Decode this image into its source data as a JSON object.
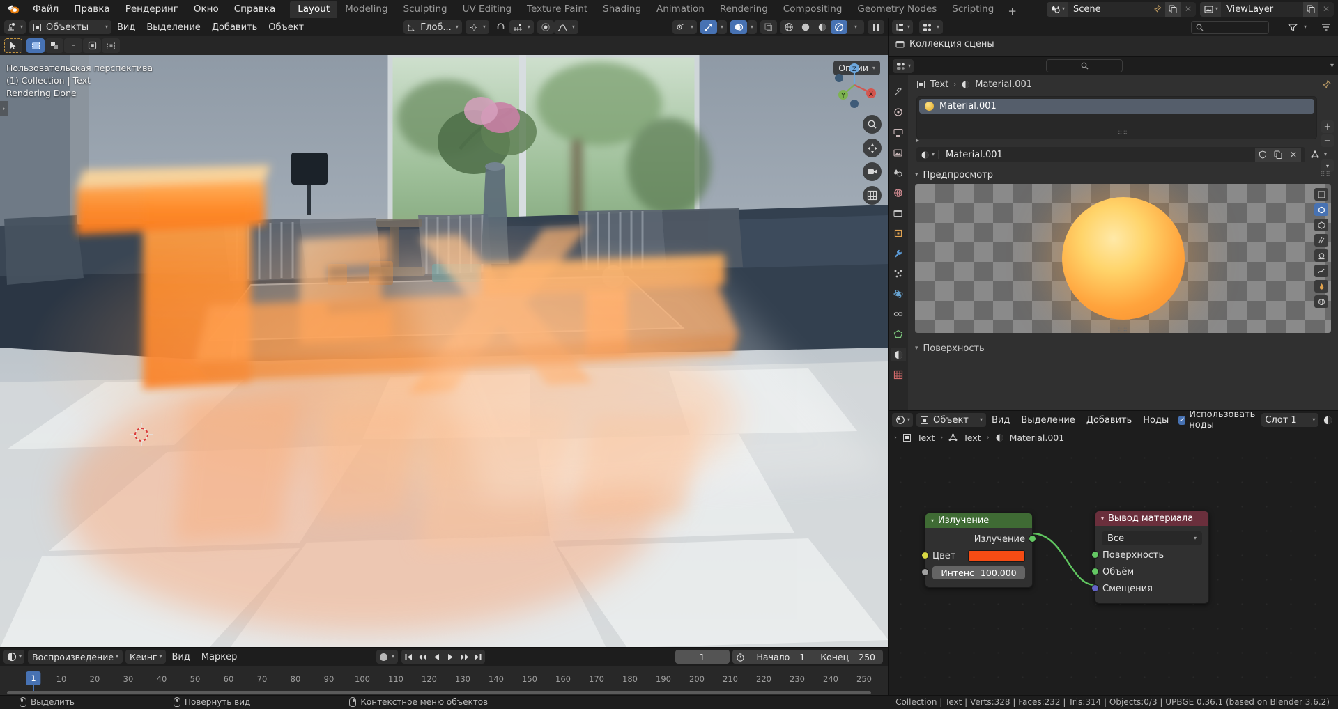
{
  "topbar": {
    "logo": "blender-logo",
    "menus": [
      "Файл",
      "Правка",
      "Рендеринг",
      "Окно",
      "Справка"
    ],
    "workspaces": [
      {
        "label": "Layout",
        "active": true
      },
      {
        "label": "Modeling",
        "active": false
      },
      {
        "label": "Sculpting",
        "active": false
      },
      {
        "label": "UV Editing",
        "active": false
      },
      {
        "label": "Texture Paint",
        "active": false
      },
      {
        "label": "Shading",
        "active": false
      },
      {
        "label": "Animation",
        "active": false
      },
      {
        "label": "Rendering",
        "active": false
      },
      {
        "label": "Compositing",
        "active": false
      },
      {
        "label": "Geometry Nodes",
        "active": false
      },
      {
        "label": "Scripting",
        "active": false
      }
    ],
    "add_workspace": "+",
    "scene": {
      "label": "Scene",
      "icon": "scene-icon"
    },
    "view_layer": {
      "label": "ViewLayer",
      "icon": "viewlayer-icon"
    }
  },
  "viewport": {
    "header": {
      "mode": "Объекты",
      "menus": [
        "Вид",
        "Выделение",
        "Добавить",
        "Объект"
      ],
      "transform_orientation": "Глоб...",
      "snap_icon": "magnet-icon",
      "proportional_icon": "proportional-edit-icon"
    },
    "toolbar": {
      "tools": [
        "tweak-tool",
        "select-box",
        "select-circle",
        "select-lasso"
      ]
    },
    "overlay": {
      "line1": "Пользовательская перспектива",
      "line2": "(1) Collection | Text",
      "line3": "Rendering Done"
    },
    "options_label": "Опции",
    "axis_labels": {
      "x": "X",
      "y": "Y",
      "z": "Z"
    },
    "gizmo_buttons": [
      "zoom-icon",
      "pan-icon",
      "camera-view-icon",
      "toggle-ortho-icon"
    ]
  },
  "timeline": {
    "editor_icon": "timeline-icon",
    "menus": [
      {
        "label": "Воспроизведение",
        "dropdown": true
      },
      {
        "label": "Кеинг",
        "dropdown": true
      },
      {
        "label": "Вид",
        "dropdown": false
      },
      {
        "label": "Маркер",
        "dropdown": false
      }
    ],
    "transport": [
      "jump-start",
      "prev-keyframe",
      "play-reverse",
      "play",
      "next-keyframe",
      "jump-end"
    ],
    "current_frame": "1",
    "start_label": "Начало",
    "start_value": "1",
    "end_label": "Конец",
    "end_value": "250",
    "playhead_label": "1",
    "ticks": [
      "10",
      "20",
      "30",
      "40",
      "50",
      "60",
      "70",
      "80",
      "90",
      "100",
      "110",
      "120",
      "130",
      "140",
      "150",
      "160",
      "170",
      "180",
      "190",
      "200",
      "210",
      "220",
      "230",
      "240",
      "250"
    ]
  },
  "outliner": {
    "display_mode_icon": "outliner-icon",
    "filter_icon": "filter-icon",
    "search_placeholder": "",
    "rows": [
      {
        "icon": "collection-icon",
        "label": "Коллекция сцены"
      }
    ]
  },
  "properties": {
    "editor_icon": "properties-icon",
    "tabs": [
      {
        "name": "tool-tab",
        "icon": "tool-icon",
        "active": false
      },
      {
        "name": "render-tab",
        "icon": "render-icon",
        "active": false
      },
      {
        "name": "output-tab",
        "icon": "output-icon",
        "active": false
      },
      {
        "name": "viewlayer-tab",
        "icon": "viewlayer-icon",
        "active": false
      },
      {
        "name": "scene-tab",
        "icon": "scene-icon",
        "active": false
      },
      {
        "name": "world-tab",
        "icon": "world-icon",
        "active": false
      },
      {
        "name": "collection-tab",
        "icon": "collection-props-icon",
        "active": false
      },
      {
        "name": "object-tab",
        "icon": "object-icon",
        "active": false
      },
      {
        "name": "modifier-tab",
        "icon": "wrench-icon",
        "active": false
      },
      {
        "name": "particles-tab",
        "icon": "particles-icon",
        "active": false
      },
      {
        "name": "physics-tab",
        "icon": "physics-icon",
        "active": false
      },
      {
        "name": "constraints-tab",
        "icon": "constraints-icon",
        "active": false
      },
      {
        "name": "data-tab",
        "icon": "data-icon",
        "active": false
      },
      {
        "name": "material-tab",
        "icon": "material-icon",
        "active": true
      },
      {
        "name": "texture-tab",
        "icon": "texture-icon",
        "active": false
      }
    ],
    "breadcrumb": [
      {
        "icon": "object-icon",
        "label": "Text"
      },
      {
        "icon": "material-icon",
        "label": "Material.001"
      }
    ],
    "material_slot": {
      "label": "Material.001",
      "icon": "material-sphere-icon"
    },
    "slot_buttons": [
      "+",
      "−",
      "▾"
    ],
    "material_id_field": {
      "icon": "material-icon",
      "value": "Material.001",
      "buttons": [
        "shield-icon",
        "copy-icon",
        "close-icon"
      ],
      "nodetree_icon": "nodetree-icon"
    },
    "preview_panel": {
      "title": "Предпросмотр"
    },
    "preview_shapes": [
      "flat-preview",
      "sphere-preview",
      "cube-preview",
      "hair-preview",
      "shaderball-preview",
      "cloth-preview",
      "fluid-preview",
      "world-preview"
    ],
    "next_panel_title": "Поверхность"
  },
  "shader_editor": {
    "editor_icon": "shading-icon",
    "shader_type": "Объект",
    "menus": [
      "Вид",
      "Выделение",
      "Добавить",
      "Ноды"
    ],
    "use_nodes_label": "Использовать ноды",
    "use_nodes_checked": true,
    "slot": "Слот 1",
    "breadcrumb": [
      {
        "icon": "object-icon",
        "label": "Text"
      },
      {
        "icon": "mesh-data-icon",
        "label": "Text"
      },
      {
        "icon": "material-icon",
        "label": "Material.001"
      }
    ],
    "nodes": [
      {
        "name": "emission-node",
        "title": "Излучение",
        "header_color": "#3f6b34",
        "output_socket": {
          "label": "Излучение",
          "color": "#63c763"
        },
        "inputs": [
          {
            "label": "Цвет",
            "socket_color": "#d8d843",
            "type": "color",
            "value": "#f64c14"
          },
          {
            "label": "Интенс",
            "socket_color": "#a1a1a1",
            "type": "value",
            "value": "100.000"
          }
        ]
      },
      {
        "name": "material-output-node",
        "title": "Вывод материала",
        "header_color": "#6a2f3c",
        "target": "Все",
        "inputs": [
          {
            "label": "Поверхность",
            "socket_color": "#63c763"
          },
          {
            "label": "Объём",
            "socket_color": "#63c763"
          },
          {
            "label": "Смещения",
            "socket_color": "#6363c7"
          }
        ]
      }
    ],
    "link_color": "#60c660"
  },
  "statusbar": {
    "hints": [
      {
        "icon": "mouse-left-icon",
        "label": "Выделить"
      },
      {
        "icon": "mouse-middle-icon",
        "label": "Повернуть вид"
      },
      {
        "icon": "mouse-right-icon",
        "label": "Контекстное меню объектов"
      }
    ],
    "stats": "Collection | Text | Verts:328 | Faces:232 | Tris:314 | Objects:0/3 | UPBGE 0.36.1 (based on Blender 3.6.2)"
  },
  "colors": {
    "accent_blue": "#4772b3",
    "emission_green": "#3f6b34",
    "output_maroon": "#6a2f3c",
    "emission_color": "#f64c14",
    "background_dark": "#1d1d1d",
    "panel_gray": "#303030"
  }
}
